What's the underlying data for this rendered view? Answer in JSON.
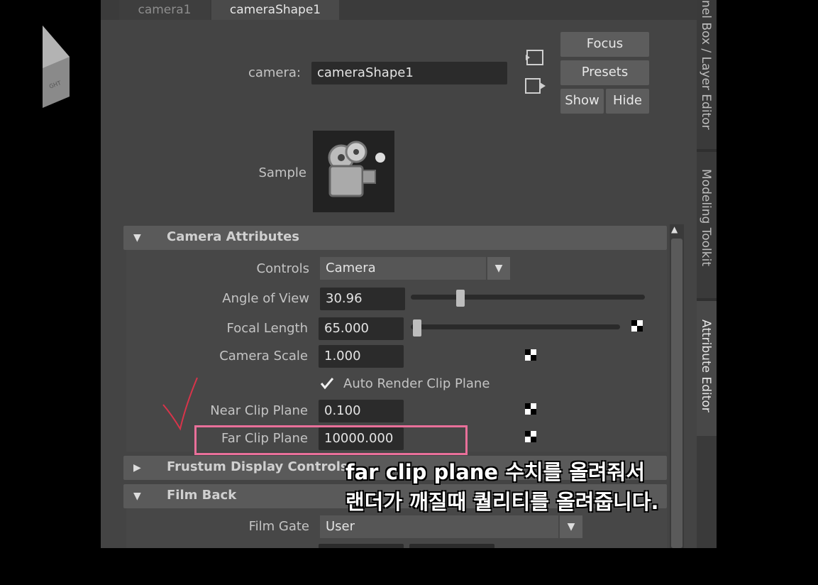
{
  "tabs": [
    {
      "label": "camera1",
      "active": false
    },
    {
      "label": "cameraShape1",
      "active": true
    }
  ],
  "node": {
    "label": "camera:",
    "value": "cameraShape1",
    "sample_label": "Sample"
  },
  "buttons": {
    "focus": "Focus",
    "presets": "Presets",
    "show": "Show",
    "hide": "Hide"
  },
  "sections": {
    "camera_attributes": "Camera Attributes",
    "frustum_display": "Frustum Display Controls",
    "film_back": "Film Back"
  },
  "attributes": {
    "controls": {
      "label": "Controls",
      "value": "Camera"
    },
    "angle_of_view": {
      "label": "Angle of View",
      "value": "30.96",
      "slider_pos": 0.2
    },
    "focal_length": {
      "label": "Focal Length",
      "value": "65.000",
      "slider_pos": 0.0
    },
    "camera_scale": {
      "label": "Camera Scale",
      "value": "1.000"
    },
    "auto_render_clip": {
      "label": "Auto Render Clip Plane",
      "checked": true
    },
    "near_clip": {
      "label": "Near Clip Plane",
      "value": "0.100"
    },
    "far_clip": {
      "label": "Far Clip Plane",
      "value": "10000.000"
    },
    "film_gate": {
      "label": "Film Gate",
      "value": "User"
    }
  },
  "side_tabs": {
    "channel_box": "nel Box / Layer Editor",
    "modeling_toolkit": "Modeling Toolkit",
    "attribute_editor": "Attribute Editor"
  },
  "annotation": {
    "line1": "far clip plane 수치를 올려줘서",
    "line2": "랜더가 깨질때 퀄리티를 올려줍니다.",
    "color": "#e9709a"
  }
}
